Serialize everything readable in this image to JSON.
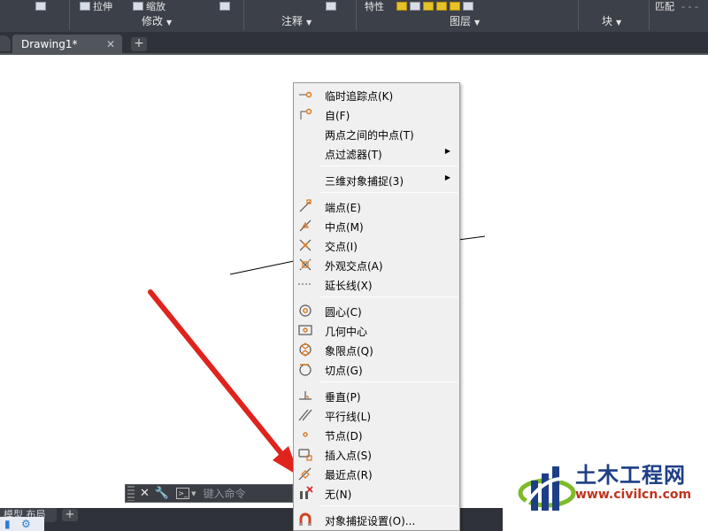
{
  "ribbon": {
    "row1": {
      "stretch": "拉伸",
      "scale": "缩放",
      "properties": "特性",
      "match": "匹配"
    },
    "panels": {
      "modify": "修改",
      "annotation": "注释",
      "layers": "图层",
      "block": "块"
    }
  },
  "tabs": {
    "document": "Drawing1*",
    "close_symbol": "✕",
    "new_symbol": "+"
  },
  "command_line": {
    "placeholder": "键入命令"
  },
  "layout_tabs": {
    "model_label": "模型  布局",
    "add_symbol": "+"
  },
  "context_menu": {
    "groups": [
      [
        {
          "label": "临时追踪点(K)",
          "icon": "temp-track-icon"
        },
        {
          "label": "自(F)",
          "icon": "from-icon"
        },
        {
          "label": "两点之间的中点(T)",
          "icon": "none"
        },
        {
          "label": "点过滤器(T)",
          "icon": "none",
          "submenu": true
        }
      ],
      [
        {
          "label": "三维对象捕捉(3)",
          "icon": "none",
          "submenu": true
        }
      ],
      [
        {
          "label": "端点(E)",
          "icon": "endpoint-icon"
        },
        {
          "label": "中点(M)",
          "icon": "midpoint-icon"
        },
        {
          "label": "交点(I)",
          "icon": "intersection-icon"
        },
        {
          "label": "外观交点(A)",
          "icon": "apparent-intersection-icon"
        },
        {
          "label": "延长线(X)",
          "icon": "extension-icon"
        }
      ],
      [
        {
          "label": "圆心(C)",
          "icon": "center-icon"
        },
        {
          "label": "几何中心",
          "icon": "geometric-center-icon"
        },
        {
          "label": "象限点(Q)",
          "icon": "quadrant-icon"
        },
        {
          "label": "切点(G)",
          "icon": "tangent-icon"
        }
      ],
      [
        {
          "label": "垂直(P)",
          "icon": "perpendicular-icon"
        },
        {
          "label": "平行线(L)",
          "icon": "parallel-icon"
        },
        {
          "label": "节点(D)",
          "icon": "node-icon"
        },
        {
          "label": "插入点(S)",
          "icon": "insertion-icon"
        },
        {
          "label": "最近点(R)",
          "icon": "nearest-icon"
        },
        {
          "label": "无(N)",
          "icon": "none-snap-icon"
        }
      ],
      [
        {
          "label": "对象捕捉设置(O)...",
          "icon": "osnap-settings-icon"
        }
      ]
    ],
    "submenu_arrow": "▶"
  },
  "watermark": {
    "title": "土木工程网",
    "url": "www.civilcn.com"
  },
  "colors": {
    "ribbon_bg": "#3c4048",
    "menu_bg": "#f0f0f0",
    "snap_icon_orange": "#d8761a",
    "arrow_red": "#e0231c",
    "watermark_blue": "#1e3f86",
    "watermark_red": "#c0331e"
  }
}
